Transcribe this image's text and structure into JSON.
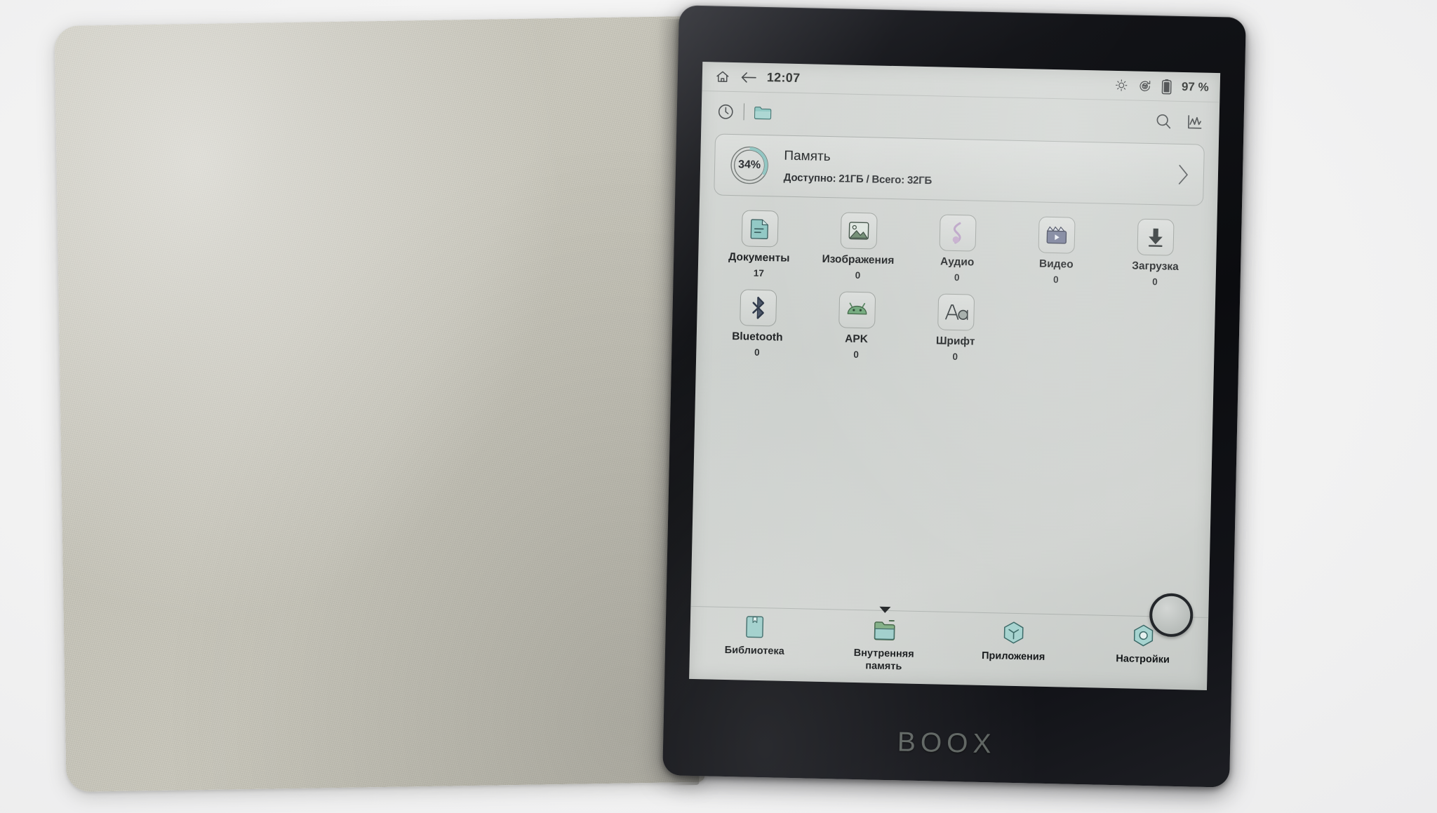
{
  "device": {
    "brand": "BOOX"
  },
  "statusbar": {
    "home_icon": "home-icon",
    "back_icon": "back-arrow-icon",
    "time": "12:07",
    "brightness_icon": "brightness-icon",
    "refresh_icon": "refresh-mode-icon",
    "battery_icon": "battery-icon",
    "battery_text": "97 %"
  },
  "toolbar": {
    "recent_icon": "clock-icon",
    "folder_icon": "folder-icon",
    "search_icon": "search-icon",
    "analytics_icon": "analytics-icon"
  },
  "storage": {
    "percent_label": "34%",
    "percent_value": 34,
    "title": "Память",
    "subtitle": "Доступно: 21ГБ / Всего: 32ГБ",
    "chevron_icon": "chevron-right-icon"
  },
  "categories": [
    {
      "label": "Документы",
      "count": "17",
      "icon": "document-icon"
    },
    {
      "label": "Изображения",
      "count": "0",
      "icon": "image-icon"
    },
    {
      "label": "Аудио",
      "count": "0",
      "icon": "audio-note-icon"
    },
    {
      "label": "Видео",
      "count": "0",
      "icon": "video-clapper-icon"
    },
    {
      "label": "Загрузка",
      "count": "0",
      "icon": "download-icon"
    },
    {
      "label": "Bluetooth",
      "count": "0",
      "icon": "bluetooth-icon"
    },
    {
      "label": "APK",
      "count": "0",
      "icon": "android-icon"
    },
    {
      "label": "Шрифт",
      "count": "0",
      "icon": "font-aa-icon"
    }
  ],
  "bottomnav": {
    "items": [
      {
        "label": "Библиотека",
        "icon": "library-icon",
        "active": false
      },
      {
        "label": "Внутренняя память",
        "icon": "storage-icon",
        "active": true
      },
      {
        "label": "Приложения",
        "icon": "apps-icon",
        "active": false
      },
      {
        "label": "Настройки",
        "icon": "settings-icon",
        "active": false
      }
    ]
  },
  "colors": {
    "accent_teal": "#8fc6c2",
    "icon_stroke": "#2a3a3c",
    "screen_bg": "#d2d5d2",
    "bezel": "#101114"
  }
}
